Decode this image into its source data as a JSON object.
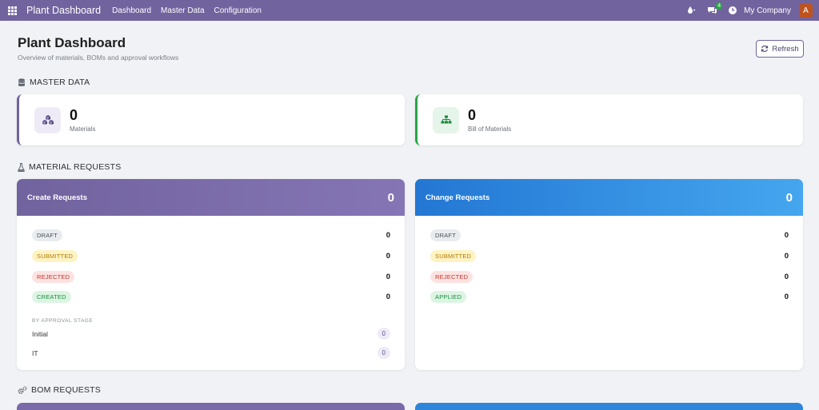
{
  "navbar": {
    "brand": "Plant Dashboard",
    "menu": [
      "Dashboard",
      "Master Data",
      "Configuration"
    ],
    "chat_badge": "4",
    "company": "My Company",
    "avatar_letter": "A"
  },
  "header": {
    "title": "Plant Dashboard",
    "subtitle": "Overview of materials, BOMs and approval workflows",
    "refresh_label": "Refresh"
  },
  "sections": {
    "master_data": "MASTER DATA",
    "material_requests": "MATERIAL REQUESTS",
    "bom_requests": "BOM REQUESTS"
  },
  "master_data": {
    "materials": {
      "value": "0",
      "label": "Materials"
    },
    "boms": {
      "value": "0",
      "label": "Bill of Materials"
    }
  },
  "create_requests": {
    "title": "Create Requests",
    "total": "0",
    "statuses": [
      {
        "label": "DRAFT",
        "count": "0"
      },
      {
        "label": "SUBMITTED",
        "count": "0"
      },
      {
        "label": "REJECTED",
        "count": "0"
      },
      {
        "label": "CREATED",
        "count": "0"
      }
    ],
    "stage_caption": "BY APPROVAL STAGE",
    "stages": [
      {
        "name": "Initial",
        "count": "0"
      },
      {
        "name": "IT",
        "count": "0"
      }
    ]
  },
  "change_requests": {
    "title": "Change Requests",
    "total": "0",
    "statuses": [
      {
        "label": "DRAFT",
        "count": "0"
      },
      {
        "label": "SUBMITTED",
        "count": "0"
      },
      {
        "label": "REJECTED",
        "count": "0"
      },
      {
        "label": "APPLIED",
        "count": "0"
      }
    ]
  },
  "colors": {
    "navbar": "#71639e",
    "create_header": "#71639e",
    "change_header": "#2377d3",
    "avatar": "#c0531d"
  }
}
